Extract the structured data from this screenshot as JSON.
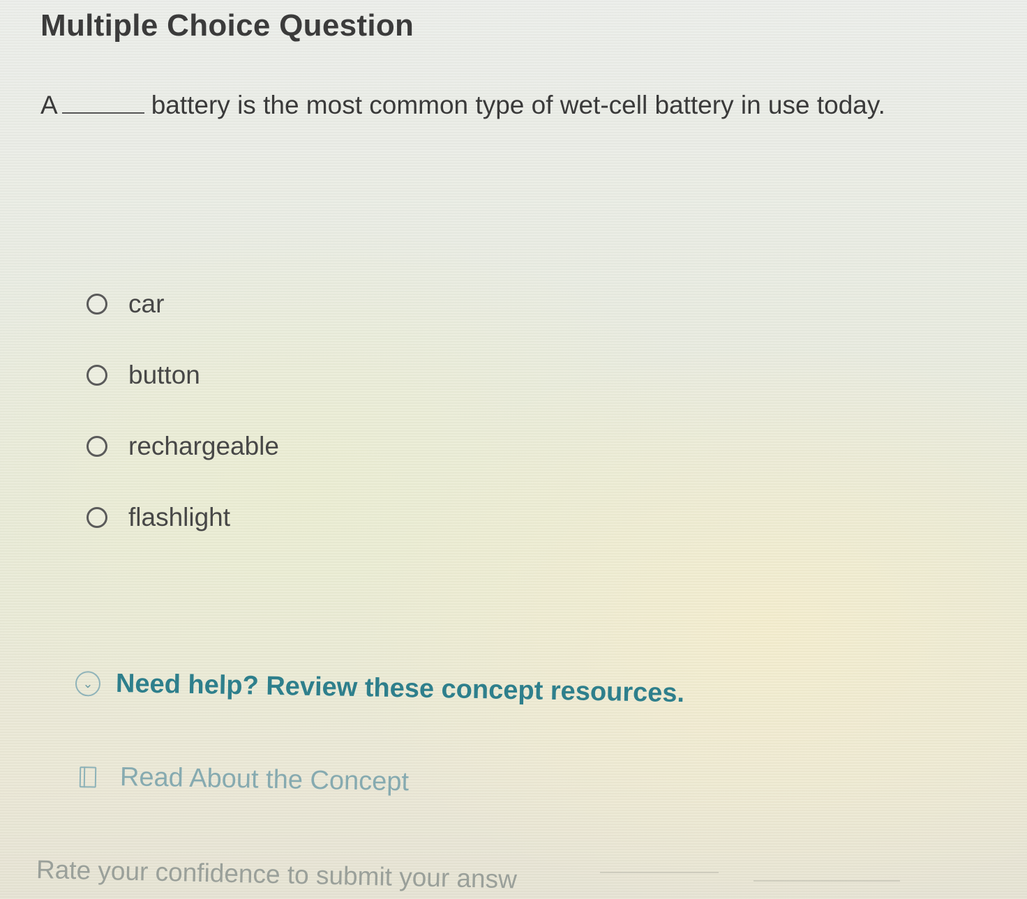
{
  "title": "Multiple Choice Question",
  "question": {
    "prefix": "A",
    "suffix": "battery is the most common type of wet-cell battery in use today."
  },
  "options": [
    {
      "label": "car"
    },
    {
      "label": "button"
    },
    {
      "label": "rechargeable"
    },
    {
      "label": "flashlight"
    }
  ],
  "help": {
    "icon": "chevron-down-icon",
    "text": "Need help? Review these concept resources."
  },
  "resources": {
    "icon": "book-icon",
    "read_label": "Read About the Concept"
  },
  "confidence": {
    "text": "Rate your confidence to submit your answ"
  }
}
